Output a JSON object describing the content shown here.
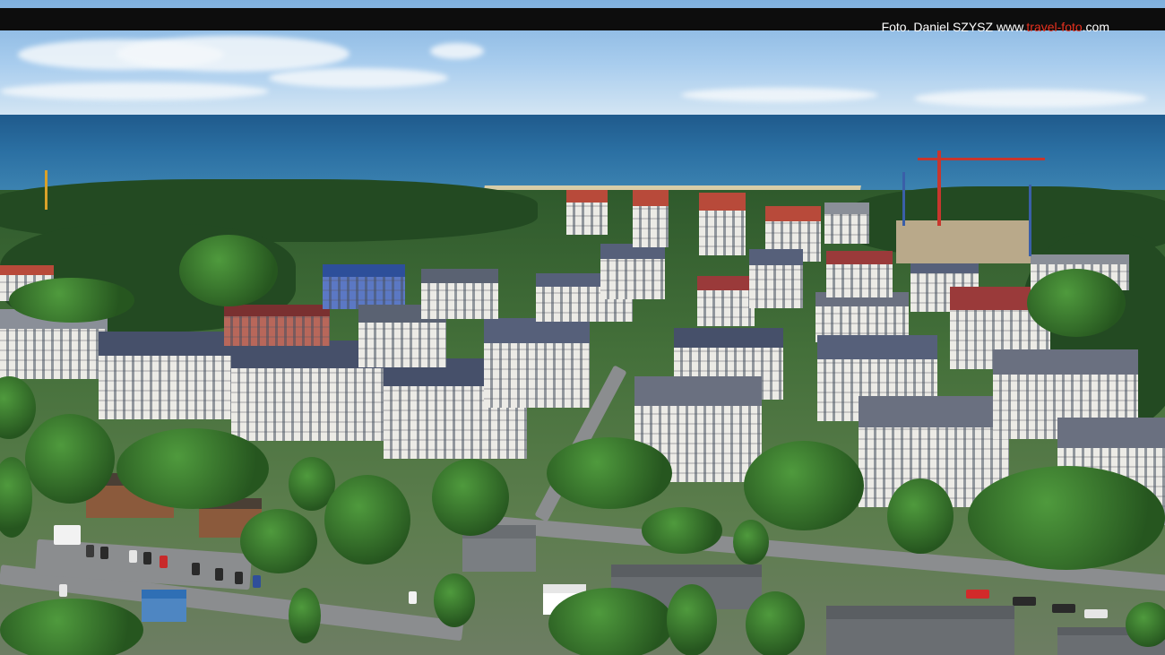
{
  "photo_credit": {
    "prefix": "Foto. Daniel SZYSZ www.",
    "highlight": "travel-foto",
    "suffix": ".com"
  },
  "scene": {
    "subject": "aerial-photo",
    "colors": {
      "sky": "#a9cdee",
      "sea": "#2b70a3",
      "forest": "#234a22",
      "roof": "#46506a",
      "facade": "#ecebe6",
      "banner": "#0d0d0d",
      "credit_text": "#ffffff",
      "credit_accent": "#e8311f"
    }
  }
}
